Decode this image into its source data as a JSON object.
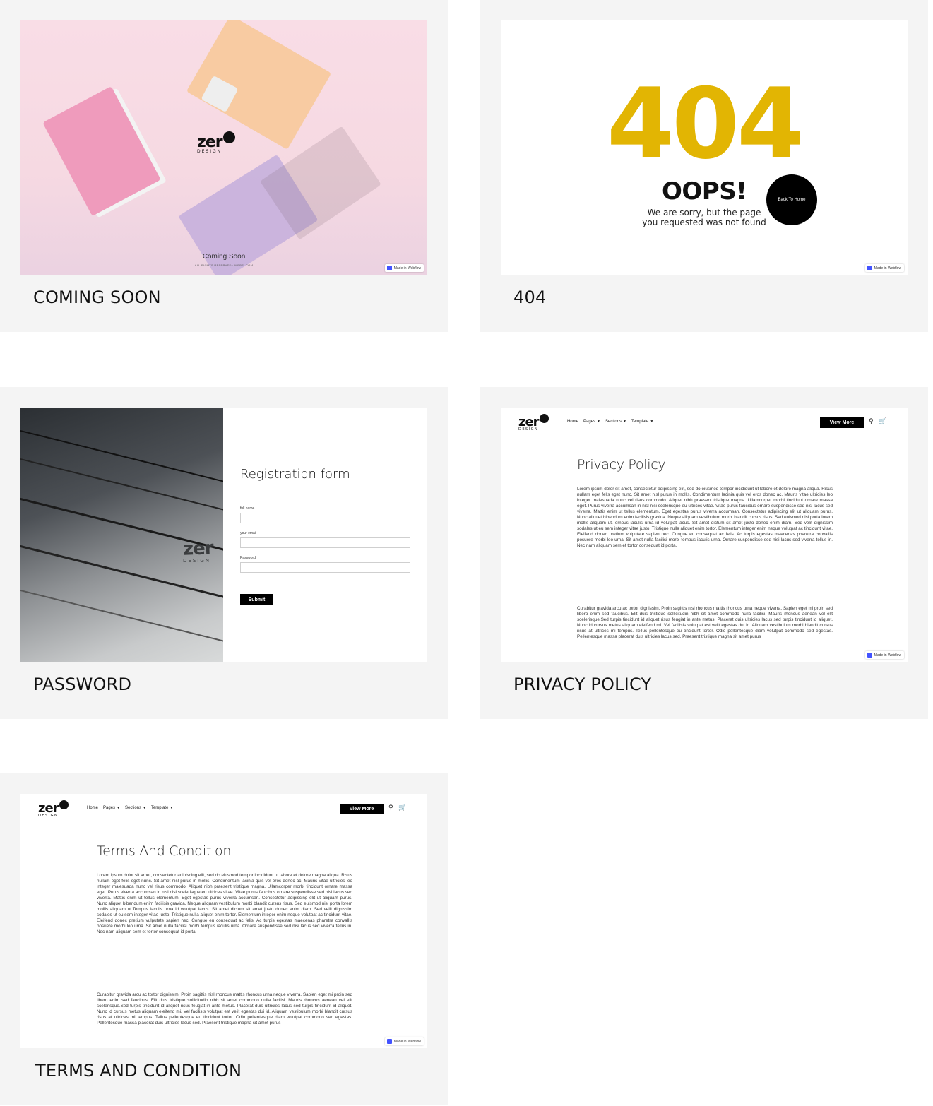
{
  "cards": {
    "coming_soon": {
      "label": "COMING SOON",
      "logo_word": "zer",
      "logo_sub": "DESIGN",
      "heading": "Coming Soon",
      "rights": "ALL RIGHTS RESERVED · WEBSI.COM",
      "badge": "Made in Webflow"
    },
    "not_found": {
      "label": "404",
      "big_code": "404",
      "headline": "OOPS!",
      "message": "We are sorry, but the page you requested was not found",
      "button": "Back To Home",
      "badge": "Made in Webflow",
      "accent_color": "#e2b503"
    },
    "password": {
      "label": "PASSWORD",
      "logo_word": "zer",
      "logo_sub": "DESIGN",
      "form_title": "Registration form",
      "fields": [
        {
          "label": "full name",
          "value": ""
        },
        {
          "label": "your email",
          "value": ""
        },
        {
          "label": "Password",
          "value": ""
        }
      ],
      "submit": "Submit"
    },
    "privacy": {
      "label": "PRIVACY POLICY",
      "title": "Privacy Policy",
      "badge": "Made in Webflow",
      "para1": "Lorem ipsum dolor sit amet, consectetur adipiscing elit, sed do eiusmod tempor incididunt ut labore et dolore magna aliqua. Risus nullam eget felis eget nunc. Sit amet nisl purus in mollis. Condimentum lacinia quis vel eros donec ac. Mauris vitae ultricies leo integer malesuada nunc vel risus commodo. Aliquet nibh praesent tristique magna. Ullamcorper morbi tincidunt ornare massa eget. Purus viverra accumsan in nisl nisi scelerisque eu ultrices vitae. Vitae purus faucibus ornare suspendisse sed nisi lacus sed viverra. Mattis enim ut tellus elementum. Eget egestas purus viverra accumsan. Consectetur adipiscing elit ut aliquam purus. Nunc aliquet bibendum enim facilisis gravida. Neque aliquam vestibulum morbi blandit cursus risus. Sed euismod nisi porta lorem mollis aliquam ut.Tempus iaculis urna id volutpat lacus. Sit amet dictum sit amet justo donec enim diam. Sed velit dignissim sodales ut eu sem integer vitae justo. Tristique nulla aliquet enim tortor. Elementum integer enim neque volutpat ac tincidunt vitae. Eleifend donec pretium vulputate sapien nec. Congue eu consequat ac felis. Ac turpis egestas maecenas pharetra convallis posuere morbi leo urna. Sit amet nulla facilisi morbi tempus iaculis urna. Ornare suspendisse sed nisi lacus sed viverra tellus in. Nec nam aliquam sem et tortor consequat id porta.",
      "para2": "Curabitur gravida arcu ac tortor dignissim. Proin sagittis nisl rhoncus mattis rhoncus urna neque viverra. Sapien eget mi proin sed libero enim sed faucibus. Elit duis tristique sollicitudin nibh sit amet commodo nulla facilisi. Mauris rhoncus aenean vel elit scelerisque.Sed turpis tincidunt id aliquet risus feugiat in ante metus. Placerat duis ultricies lacus sed turpis tincidunt id aliquet. Nunc id cursus metus aliquam eleifend mi. Vel facilisis volutpat est velit egestas dui id. Aliquam vestibulum morbi blandit cursus risus at ultrices mi tempus. Tellus pellentesque eu tincidunt tortor. Odio pellentesque diam volutpat commodo sed egestas. Pellentesque massa placerat duis ultricies lacus sed. Praesent tristique magna sit amet purus"
    },
    "terms": {
      "label": "TERMS AND CONDITION",
      "title": "Terms And Condition",
      "badge": "Made in Webflow",
      "para1": "Lorem ipsum dolor sit amet, consectetur adipiscing elit, sed do eiusmod tempor incididunt ut labore et dolore magna aliqua. Risus nullam eget felis eget nunc. Sit amet nisl purus in mollis. Condimentum lacinia quis vel eros donec ac. Mauris vitae ultricies leo integer malesuada nunc vel risus commodo. Aliquet nibh praesent tristique magna. Ullamcorper morbi tincidunt ornare massa eget. Purus viverra accumsan in nisl nisi scelerisque eu ultrices vitae. Vitae purus faucibus ornare suspendisse sed nisi lacus sed viverra. Mattis enim ut tellus elementum. Eget egestas purus viverra accumsan. Consectetur adipiscing elit ut aliquam purus. Nunc aliquet bibendum enim facilisis gravida. Neque aliquam vestibulum morbi blandit cursus risus. Sed euismod nisi porta lorem mollis aliquam ut.Tempus iaculis urna id volutpat lacus. Sit amet dictum sit amet justo donec enim diam. Sed velit dignissim sodales ut eu sem integer vitae justo. Tristique nulla aliquet enim tortor. Elementum integer enim neque volutpat ac tincidunt vitae. Eleifend donec pretium vulputate sapien nec. Congue eu consequat ac felis. Ac turpis egestas maecenas pharetra convallis posuere morbi leo urna. Sit amet nulla facilisi morbi tempus iaculis urna. Ornare suspendisse sed nisi lacus sed viverra tellus in. Nec nam aliquam sem et tortor consequat id porta.",
      "para2": "Curabitur gravida arcu ac tortor dignissim. Proin sagittis nisl rhoncus mattis rhoncus urna neque viverra. Sapien eget mi proin sed libero enim sed faucibus. Elit duis tristique sollicitudin nibh sit amet commodo nulla facilisi. Mauris rhoncus aenean vel elit scelerisque.Sed turpis tincidunt id aliquet risus feugiat in ante metus. Placerat duis ultricies lacus sed turpis tincidunt id aliquet. Nunc id cursus metus aliquam eleifend mi. Vel facilisis volutpat est velit egestas dui id. Aliquam vestibulum morbi blandit cursus risus at ultrices mi tempus. Tellus pellentesque eu tincidunt tortor. Odio pellentesque diam volutpat commodo sed egestas. Pellentesque massa placerat duis ultricies lacus sed. Praesent tristique magna sit amet purus"
    }
  },
  "nav": {
    "logo_word": "zer",
    "logo_sub": "DESIGN",
    "links": [
      "Home",
      "Pages",
      "Sections",
      "Template"
    ],
    "cta": "View More",
    "icons": [
      "search-icon",
      "cart-icon"
    ]
  }
}
